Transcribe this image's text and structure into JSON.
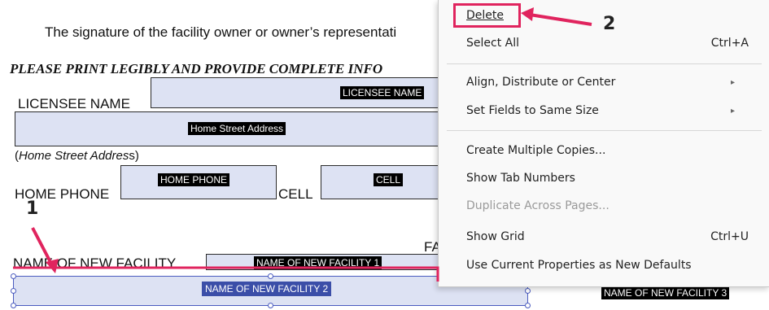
{
  "document": {
    "signature_text": "The signature of the facility owner or owner’s representati",
    "print_heading": "PLEASE PRINT LEGIBLY AND PROVIDE COMPLETE INFO",
    "licensee_label": "LICENSEE NAME",
    "licensee_field": "LICENSEE NAME",
    "home_street_field": "Home Street Address",
    "home_street_label_prefix": "(",
    "home_street_label_em": "Home Street Addres",
    "home_street_label_suffix": "s)",
    "home_phone_label": "HOME PHONE",
    "home_phone_field": "HOME PHONE",
    "cell_label": "CELL",
    "cell_field": "CELL",
    "fa_label": "FA",
    "facility_label": "NAME OF NEW FACILITY",
    "facility1_field": "NAME OF NEW FACILITY 1",
    "facility2_field": "NAME OF NEW FACILITY 2",
    "facility3_field": "NAME OF NEW FACILITY 3"
  },
  "context_menu": {
    "delete": "Delete",
    "select_all": "Select All",
    "select_all_shortcut": "Ctrl+A",
    "align": "Align, Distribute or Center",
    "same_size": "Set Fields to Same Size",
    "multiple_copies": "Create Multiple Copies...",
    "tab_numbers": "Show Tab Numbers",
    "duplicate_pages": "Duplicate Across Pages...",
    "show_grid": "Show Grid",
    "show_grid_shortcut": "Ctrl+U",
    "use_current": "Use Current Properties as New Defaults",
    "submenu_arrow": "▸"
  },
  "annotations": {
    "step1": "1",
    "step2": "2",
    "color": "#e0245e"
  }
}
